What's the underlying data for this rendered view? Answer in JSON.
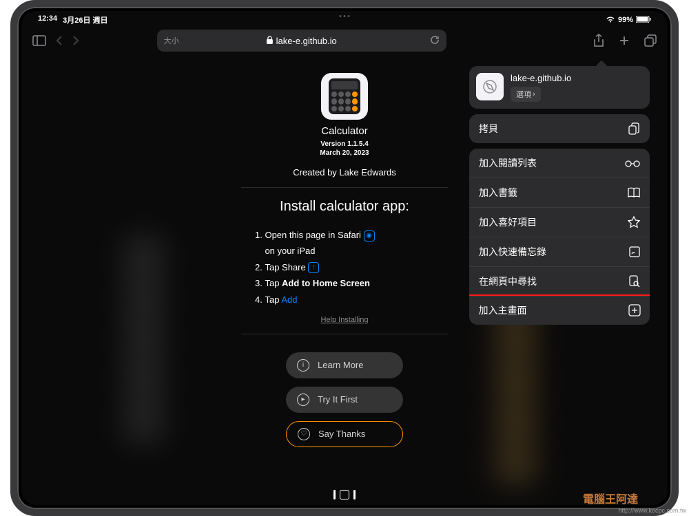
{
  "status": {
    "time": "12:34",
    "date": "3月26日 週日",
    "battery": "99%"
  },
  "browser": {
    "text_size": "大小",
    "domain": "lake-e.github.io"
  },
  "page": {
    "app_name": "Calculator",
    "version_line1": "Version 1.1.5.4",
    "version_line2": "March 20, 2023",
    "author": "Created by Lake Edwards",
    "install_title": "Install calculator app:",
    "steps": {
      "s1a": "Open this page in Safari",
      "s1b": "on your iPad",
      "s2": "Tap Share",
      "s3a": "Tap ",
      "s3b": "Add to Home Screen",
      "s4a": "Tap ",
      "s4b": "Add"
    },
    "help": "Help Installing",
    "buttons": {
      "learn": "Learn More",
      "try": "Try It First",
      "thanks": "Say Thanks"
    }
  },
  "share": {
    "site": "lake-e.github.io",
    "options": "選項",
    "copy": "拷貝",
    "items": [
      "加入閱讀列表",
      "加入書籤",
      "加入喜好項目",
      "加入快速備忘錄",
      "在網頁中尋找",
      "加入主畫面"
    ]
  },
  "watermark": {
    "brand": "電腦王阿達",
    "url": "http://www.kocpc.com.tw"
  }
}
